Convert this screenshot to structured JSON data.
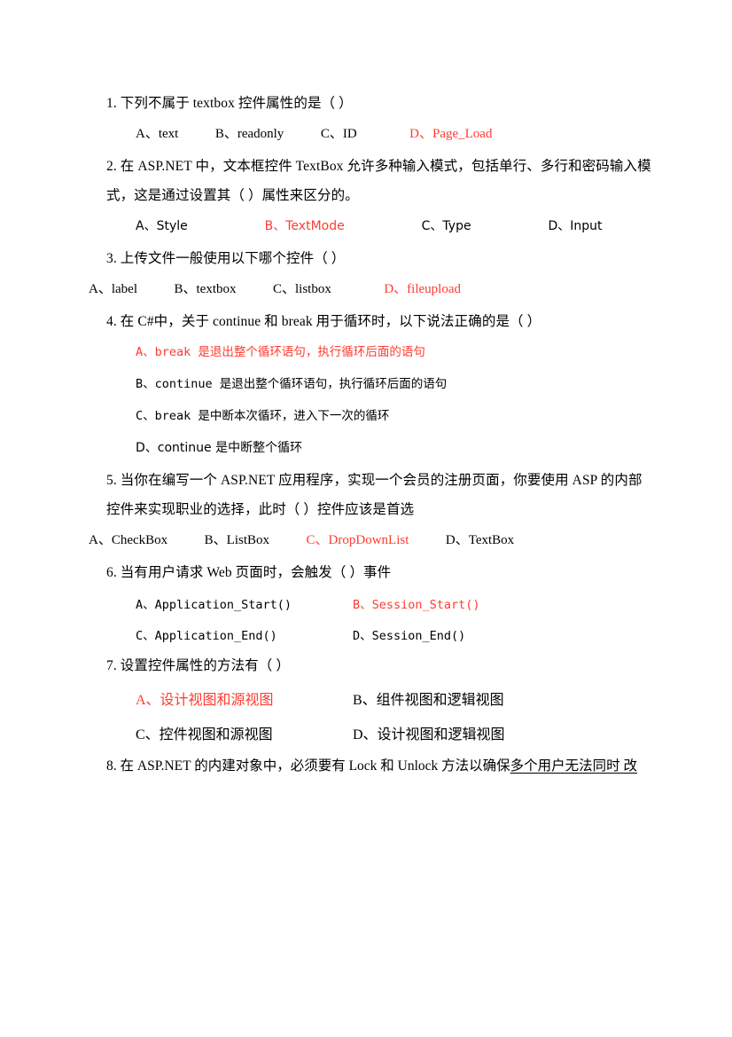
{
  "document": {
    "type": "exam-paper",
    "language": "zh-CN",
    "answer_color": "#ff3b30",
    "body_color": "#000000"
  },
  "questions": [
    {
      "number": "1.",
      "stem": "下列不属于 textbox 控件属性的是（        ）",
      "stem_lines": [
        "1.  下列不属于 textbox 控件属性的是（        ）"
      ],
      "font": "serif",
      "options_indent": "indent",
      "options_layout": "single-row",
      "options": [
        {
          "label": "A、text",
          "correct": false
        },
        {
          "label": "B、readonly",
          "correct": false
        },
        {
          "label": "C、ID",
          "correct": false
        },
        {
          "label": "D、Page_Load",
          "correct": true
        }
      ]
    },
    {
      "number": "2.",
      "stem_lines": [
        "2.  在 ASP.NET 中，文本框控件 TextBox 允许多种输入模式，包括单行、多行和密码输入模",
        "式，这是通过设置其（        ）属性来区分的。"
      ],
      "font": "sans",
      "options_indent": "indent",
      "options_layout": "single-row",
      "options": [
        {
          "label": "A、Style",
          "correct": false
        },
        {
          "label": "B、TextMode",
          "correct": true
        },
        {
          "label": "C、Type",
          "correct": false
        },
        {
          "label": "D、Input",
          "correct": false
        }
      ]
    },
    {
      "number": "3.",
      "stem_lines": [
        "3.  上传文件一般使用以下哪个控件（  ）"
      ],
      "font": "serif",
      "options_indent": "noindent",
      "options_layout": "single-row",
      "options": [
        {
          "label": "A、label",
          "correct": false
        },
        {
          "label": "B、textbox",
          "correct": false
        },
        {
          "label": "C、listbox",
          "correct": false
        },
        {
          "label": "D、fileupload",
          "correct": true
        }
      ]
    },
    {
      "number": "4.",
      "stem_lines": [
        "4.  在 C#中，关于 continue 和 break 用于循环时，以下说法正确的是（        ）"
      ],
      "font": "mono",
      "options_indent": "indent",
      "options_layout": "stacked",
      "options": [
        {
          "label": "A、break 是退出整个循环语句，执行循环后面的语句",
          "correct": true,
          "font": "mono"
        },
        {
          "label": "B、continue 是退出整个循环语句，执行循环后面的语句",
          "correct": false,
          "font": "mono"
        },
        {
          "label": "C、break 是中断本次循环，进入下一次的循环",
          "correct": false,
          "font": "mono"
        },
        {
          "label": "D、continue 是中断整个循环",
          "correct": false,
          "font": "sans"
        }
      ]
    },
    {
      "number": "5.",
      "stem_lines": [
        "5.  当你在编写一个 ASP.NET 应用程序，实现一个会员的注册页面，你要使用 ASP 的内部",
        "控件来实现职业的选择，此时（  ）控件应该是首选"
      ],
      "font": "serif",
      "options_indent": "noindent",
      "options_layout": "single-row",
      "options": [
        {
          "label": "A、CheckBox",
          "correct": false
        },
        {
          "label": "B、ListBox",
          "correct": false
        },
        {
          "label": "C、DropDownList",
          "correct": true
        },
        {
          "label": "D、TextBox",
          "correct": false
        }
      ]
    },
    {
      "number": "6.",
      "stem_lines": [
        "6.  当有用户请求 Web 页面时，会触发（        ）事件"
      ],
      "font": "mono",
      "options_indent": "indent",
      "options_layout": "two-column",
      "options": [
        {
          "label": "A、Application_Start()",
          "correct": false
        },
        {
          "label": "B、Session_Start()",
          "correct": true
        },
        {
          "label": "C、Application_End()",
          "correct": false
        },
        {
          "label": "D、Session_End()",
          "correct": false
        }
      ]
    },
    {
      "number": "7.",
      "stem_lines": [
        "7.  设置控件属性的方法有（  ）"
      ],
      "font": "serif",
      "options_indent": "indent",
      "options_layout": "two-column",
      "options": [
        {
          "label": "A、设计视图和源视图",
          "correct": true
        },
        {
          "label": "B、组件视图和逻辑视图",
          "correct": false
        },
        {
          "label": "C、控件视图和源视图",
          "correct": false
        },
        {
          "label": "D、设计视图和逻辑视图",
          "correct": false
        }
      ]
    },
    {
      "number": "8.",
      "stem_prefix": "8.  在 ASP.NET 的内建对象中，必须要有 Lock 和 Unlock 方法以确保",
      "stem_underlined": "多个用户无法同时 改",
      "font": "serif",
      "options": []
    }
  ]
}
